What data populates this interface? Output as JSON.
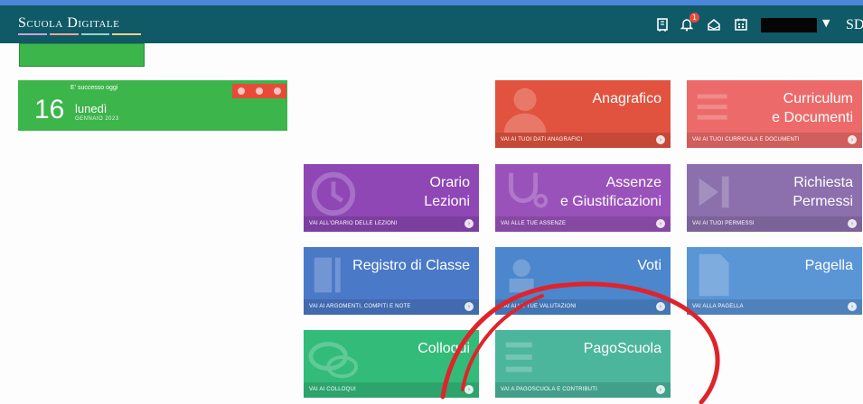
{
  "app": {
    "logo_text": "Scuola Digitale",
    "user_initials": "SD",
    "logo_stripe_colors": [
      "#c9a3d8",
      "#f2a6a0",
      "#9fd3c6",
      "#f5d38a"
    ]
  },
  "topbar": {
    "icons": [
      "book-icon",
      "bell-icon",
      "home-icon",
      "calendar-icon",
      "chevron-down-icon"
    ],
    "notification_count": "1",
    "bg_color": "#0f5a66"
  },
  "event": {
    "caption": "E' successo oggi",
    "day": "16",
    "weekday": "lunedì",
    "month_year": "GENNAIO 2023"
  },
  "tiles": {
    "anagrafico": {
      "title": "Anagrafico",
      "footer": "VAI AI TUOI DATI ANAGRAFICI",
      "color": "#e2533f"
    },
    "curriculum": {
      "title_1": "Curriculum",
      "title_2": "e Documenti",
      "footer": "VAI AI TUOI CURRICULA E DOCUMENTI",
      "color": "#ec6b6a"
    },
    "orario": {
      "title_1": "Orario",
      "title_2": "Lezioni",
      "footer": "VAI ALL'ORARIO DELLE LEZIONI",
      "color": "#8e47b5"
    },
    "assenze": {
      "title_1": "Assenze",
      "title_2": "e Giustificazioni",
      "footer": "VAI ALLE TUE ASSENZE",
      "color": "#9a52bb"
    },
    "permessi": {
      "title_1": "Richiesta",
      "title_2": "Permessi",
      "footer": "VAI AI TUOI PERMESSI",
      "color": "#8c70ad"
    },
    "registro": {
      "title": "Registro di Classe",
      "footer": "VAI AI ARGOMENTI, COMPITI E NOTE",
      "color": "#4a79c8"
    },
    "voti": {
      "title": "Voti",
      "footer": "VAI ALLE TUE VALUTAZIONI",
      "color": "#4c86cc"
    },
    "pagella": {
      "title": "Pagella",
      "footer": "VAI ALLA PAGELLA",
      "color": "#5a95d6"
    },
    "colloqui": {
      "title": "Colloqui",
      "footer": "VAI AI COLLOQUI",
      "color": "#33bb7a"
    },
    "pagoscuola": {
      "title": "PagoScuola",
      "footer": "VAI A PAGOSCUOLA E CONTRIBUTI",
      "color": "#4cb69c"
    }
  },
  "annotation_color": "#e0232b"
}
